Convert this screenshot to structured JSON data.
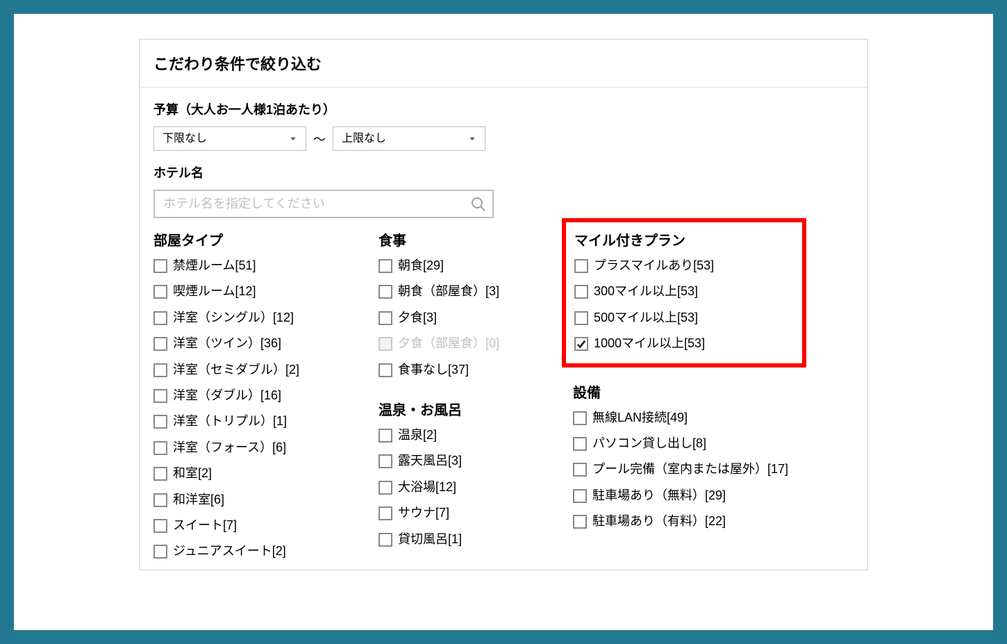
{
  "panel": {
    "title": "こだわり条件で絞り込む"
  },
  "budget": {
    "label": "予算（大人お一人様1泊あたり）",
    "lower": "下限なし",
    "upper": "上限なし",
    "separator": "～"
  },
  "hotel": {
    "label": "ホテル名",
    "placeholder": "ホテル名を指定してください"
  },
  "groups": {
    "roomType": {
      "title": "部屋タイプ",
      "items": [
        {
          "label": "禁煙ルーム[51]",
          "checked": false,
          "disabled": false
        },
        {
          "label": "喫煙ルーム[12]",
          "checked": false,
          "disabled": false
        },
        {
          "label": "洋室（シングル）[12]",
          "checked": false,
          "disabled": false
        },
        {
          "label": "洋室（ツイン）[36]",
          "checked": false,
          "disabled": false
        },
        {
          "label": "洋室（セミダブル）[2]",
          "checked": false,
          "disabled": false
        },
        {
          "label": "洋室（ダブル）[16]",
          "checked": false,
          "disabled": false
        },
        {
          "label": "洋室（トリプル）[1]",
          "checked": false,
          "disabled": false
        },
        {
          "label": "洋室（フォース）[6]",
          "checked": false,
          "disabled": false
        },
        {
          "label": "和室[2]",
          "checked": false,
          "disabled": false
        },
        {
          "label": "和洋室[6]",
          "checked": false,
          "disabled": false
        },
        {
          "label": "スイート[7]",
          "checked": false,
          "disabled": false
        },
        {
          "label": "ジュニアスイート[2]",
          "checked": false,
          "disabled": false
        }
      ]
    },
    "meal": {
      "title": "食事",
      "items": [
        {
          "label": "朝食[29]",
          "checked": false,
          "disabled": false
        },
        {
          "label": "朝食（部屋食）[3]",
          "checked": false,
          "disabled": false
        },
        {
          "label": "夕食[3]",
          "checked": false,
          "disabled": false
        },
        {
          "label": "夕食（部屋食）[0]",
          "checked": false,
          "disabled": true
        },
        {
          "label": "食事なし[37]",
          "checked": false,
          "disabled": false
        }
      ]
    },
    "bath": {
      "title": "温泉・お風呂",
      "items": [
        {
          "label": "温泉[2]",
          "checked": false,
          "disabled": false
        },
        {
          "label": "露天風呂[3]",
          "checked": false,
          "disabled": false
        },
        {
          "label": "大浴場[12]",
          "checked": false,
          "disabled": false
        },
        {
          "label": "サウナ[7]",
          "checked": false,
          "disabled": false
        },
        {
          "label": "貸切風呂[1]",
          "checked": false,
          "disabled": false
        }
      ]
    },
    "milePlan": {
      "title": "マイル付きプラン",
      "items": [
        {
          "label": "プラスマイルあり[53]",
          "checked": false,
          "disabled": false
        },
        {
          "label": "300マイル以上[53]",
          "checked": false,
          "disabled": false
        },
        {
          "label": "500マイル以上[53]",
          "checked": false,
          "disabled": false
        },
        {
          "label": "1000マイル以上[53]",
          "checked": true,
          "disabled": false
        }
      ]
    },
    "facility": {
      "title": "設備",
      "items": [
        {
          "label": "無線LAN接続[49]",
          "checked": false,
          "disabled": false
        },
        {
          "label": "パソコン貸し出し[8]",
          "checked": false,
          "disabled": false
        },
        {
          "label": "プール完備（室内または屋外）[17]",
          "checked": false,
          "disabled": false
        },
        {
          "label": "駐車場あり（無料）[29]",
          "checked": false,
          "disabled": false
        },
        {
          "label": "駐車場あり（有料）[22]",
          "checked": false,
          "disabled": false
        }
      ]
    }
  }
}
